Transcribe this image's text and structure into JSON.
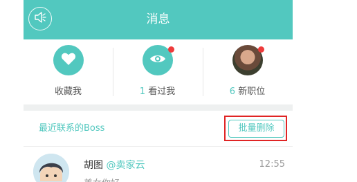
{
  "header": {
    "title": "消息",
    "speaker_icon": "speaker-icon",
    "bg_color": "#52c8bf"
  },
  "quick_actions": [
    {
      "label": "收藏我",
      "icon": "heart-icon"
    },
    {
      "count": "1",
      "label": "看过我",
      "icon": "eye-icon",
      "badge": true
    },
    {
      "count": "6",
      "label": "新职位",
      "icon": "profile-photo",
      "badge": true
    }
  ],
  "recent": {
    "label": "最近联系的Boss",
    "batch_delete_label": "批量删除"
  },
  "conversation": {
    "name": "胡图",
    "company": "@卖家云",
    "time": "12:55",
    "preview": "美女你好"
  },
  "colors": {
    "accent": "#52c8bf",
    "badge": "#ee3b3b",
    "highlight": "#e02424"
  }
}
